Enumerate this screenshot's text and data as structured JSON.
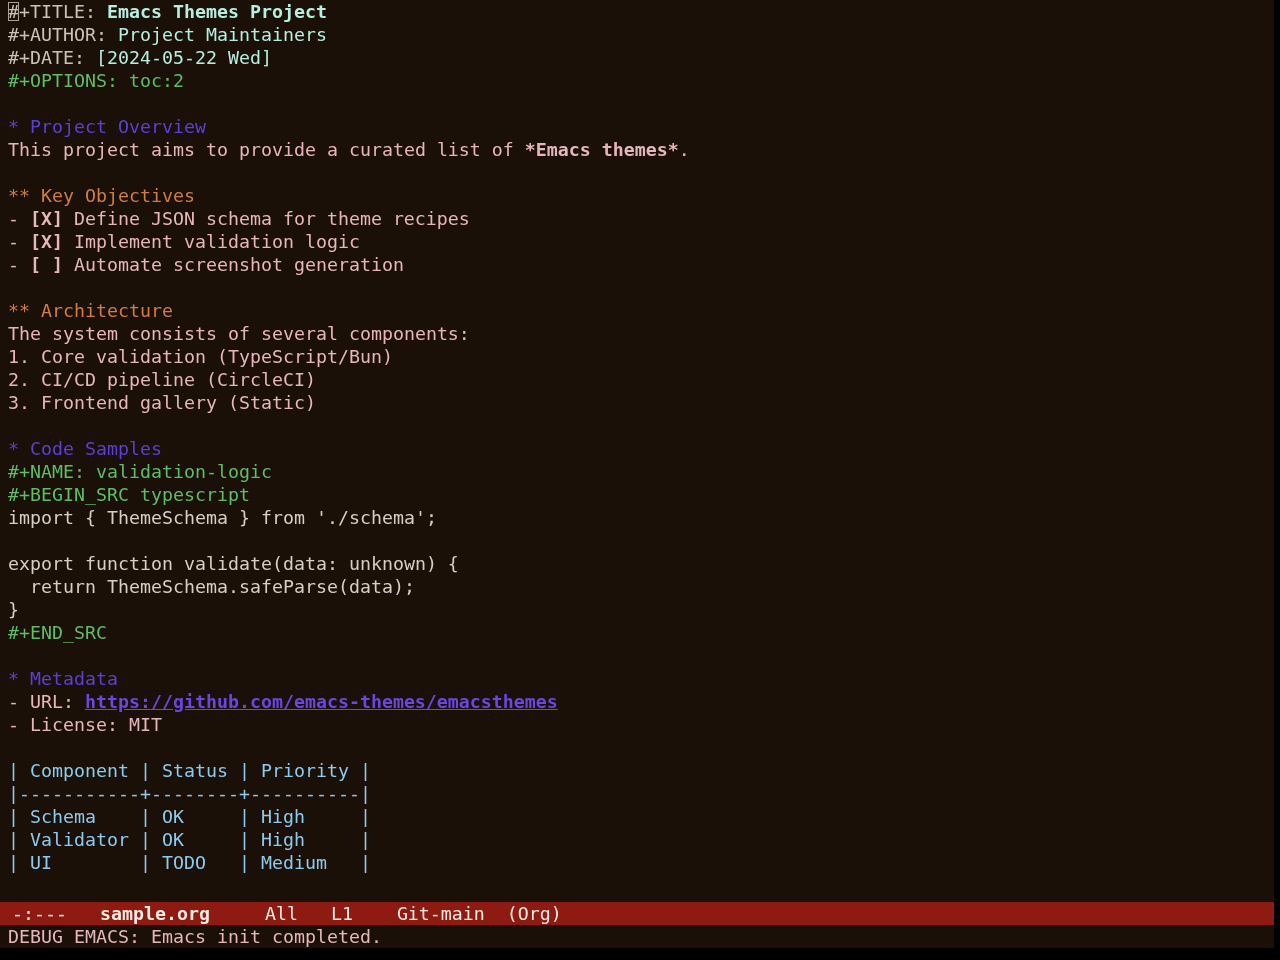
{
  "buffer": {
    "header": [
      {
        "kind": "title",
        "keyword": "#+TITLE:",
        "value": "Emacs Themes Project",
        "cursor": true
      },
      {
        "kind": "author",
        "keyword": "#+AUTHOR:",
        "value": "Project Maintainers"
      },
      {
        "kind": "date",
        "keyword": "#+DATE:",
        "value": "[2024-05-22 Wed]"
      },
      {
        "kind": "options",
        "keyword": "#+OPTIONS:",
        "value": "toc:2"
      }
    ],
    "lines": [
      {
        "kind": "blank"
      },
      {
        "kind": "heading",
        "text": "* Project Overview"
      },
      {
        "kind": "paragraph",
        "runs": [
          {
            "text": "This project aims to provide a curated list of ",
            "bold": false
          },
          {
            "text": "*Emacs themes*",
            "bold": true
          },
          {
            "text": ".",
            "bold": false
          }
        ]
      },
      {
        "kind": "blank"
      },
      {
        "kind": "subheading",
        "text": "** Key Objectives"
      },
      {
        "kind": "checkbox",
        "bullet": "-",
        "box": "[X]",
        "text": "Define JSON schema for theme recipes"
      },
      {
        "kind": "checkbox",
        "bullet": "-",
        "box": "[X]",
        "text": "Implement validation logic"
      },
      {
        "kind": "checkbox",
        "bullet": "-",
        "box": "[ ]",
        "text": "Automate screenshot generation"
      },
      {
        "kind": "blank"
      },
      {
        "kind": "subheading",
        "text": "** Architecture"
      },
      {
        "kind": "paragraph",
        "runs": [
          {
            "text": "The system consists of several components:",
            "bold": false
          }
        ]
      },
      {
        "kind": "item",
        "text": "1. Core validation (TypeScript/Bun)"
      },
      {
        "kind": "item",
        "text": "2. CI/CD pipeline (CircleCI)"
      },
      {
        "kind": "item",
        "text": "3. Frontend gallery (Static)"
      },
      {
        "kind": "blank"
      },
      {
        "kind": "heading",
        "text": "* Code Samples"
      },
      {
        "kind": "keyword",
        "text": "#+NAME: validation-logic"
      },
      {
        "kind": "keyword",
        "text": "#+BEGIN_SRC typescript"
      },
      {
        "kind": "code",
        "text": "import { ThemeSchema } from './schema';"
      },
      {
        "kind": "blank"
      },
      {
        "kind": "code",
        "text": "export function validate(data: unknown) {"
      },
      {
        "kind": "code",
        "text": "  return ThemeSchema.safeParse(data);"
      },
      {
        "kind": "code",
        "text": "}"
      },
      {
        "kind": "keyword",
        "text": "#+END_SRC"
      },
      {
        "kind": "blank"
      },
      {
        "kind": "heading",
        "text": "* Metadata"
      },
      {
        "kind": "link",
        "label": "- URL:",
        "url": "https://github.com/emacs-themes/emacsthemes"
      },
      {
        "kind": "item",
        "text": "- License: MIT"
      },
      {
        "kind": "blank"
      },
      {
        "kind": "table_row",
        "text": "| Component | Status | Priority |"
      },
      {
        "kind": "table_rule",
        "text": "|-----------+--------+----------|"
      },
      {
        "kind": "table_row",
        "text": "| Schema    | OK     | High     |"
      },
      {
        "kind": "table_row",
        "text": "| Validator | OK     | High     |"
      },
      {
        "kind": "table_row",
        "text": "| UI        | TODO   | Medium   |"
      }
    ]
  },
  "mode_line": {
    "status": "-:---",
    "buffer": "sample.org",
    "position": "All",
    "line": "L1",
    "vc": "Git-main",
    "mode": "(Org)"
  },
  "echo_area": {
    "message": "DEBUG EMACS: Emacs init completed."
  }
}
